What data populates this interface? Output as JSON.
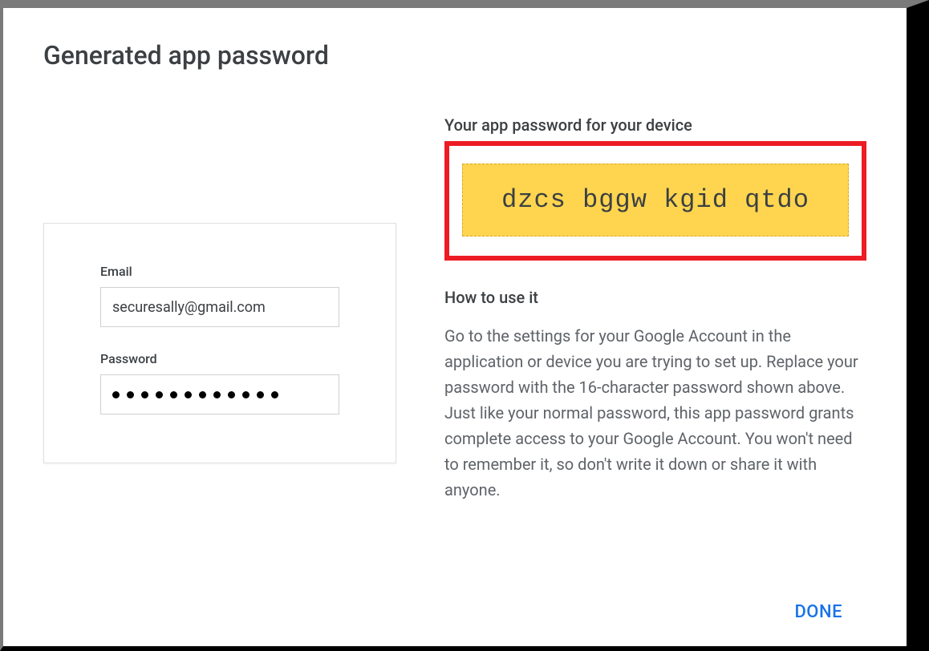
{
  "title": "Generated app password",
  "left": {
    "email_label": "Email",
    "email_value": "securesally@gmail.com",
    "password_label": "Password",
    "password_dot_count": 12
  },
  "right": {
    "password_section_label": "Your app password for your device",
    "generated_password": "dzcs bggw kgid qtdo",
    "howto_label": "How to use it",
    "instructions": "Go to the settings for your Google Account in the application or device you are trying to set up. Replace your password with the 16-character password shown above.\nJust like your normal password, this app password grants complete access to your Google Account. You won't need to remember it, so don't write it down or share it with anyone."
  },
  "done_label": "DONE"
}
